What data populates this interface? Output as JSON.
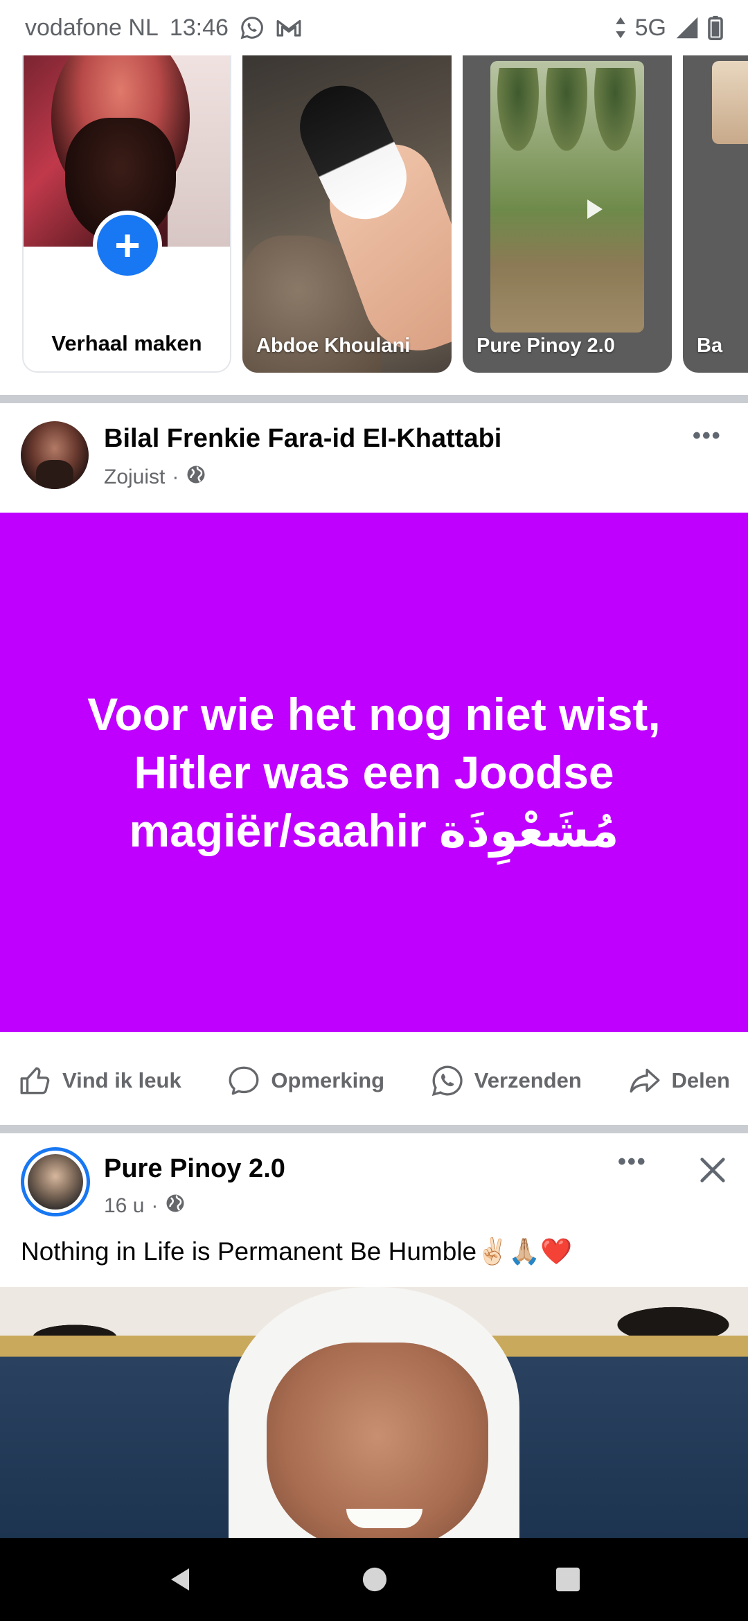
{
  "status_bar": {
    "carrier": "vodafone NL",
    "time": "13:46",
    "network": "5G",
    "icons": [
      "whatsapp-icon",
      "gmail-icon",
      "data-arrows-icon",
      "signal-icon",
      "battery-icon"
    ]
  },
  "stories": {
    "create_label": "Verhaal maken",
    "items": [
      {
        "name": "Abdoe Khoulani"
      },
      {
        "name": "Pure Pinoy 2.0"
      },
      {
        "name": "Ba"
      }
    ]
  },
  "post1": {
    "author": "Bilal Frenkie Fara-id El-Khattabi",
    "time": "Zojuist",
    "separator": "·",
    "privacy_icon": "globe-icon",
    "text": "Voor wie het nog niet wist, Hitler was een Joodse magiër/saahir مُشَعْوِذَة",
    "background_color": "#bf00ff",
    "more": "•••"
  },
  "actions": {
    "like": "Vind ik leuk",
    "comment": "Opmerking",
    "send": "Verzenden",
    "share": "Delen"
  },
  "post2": {
    "author": "Pure Pinoy 2.0",
    "time": "16 u",
    "separator": "·",
    "privacy_icon": "globe-icon",
    "caption": "Nothing in Life is Permanent Be Humble✌🏻🙏🏼❤️",
    "more": "•••"
  },
  "colors": {
    "facebook_blue": "#1877f2",
    "text_secondary": "#65676b",
    "divider": "#c9ccd1"
  }
}
